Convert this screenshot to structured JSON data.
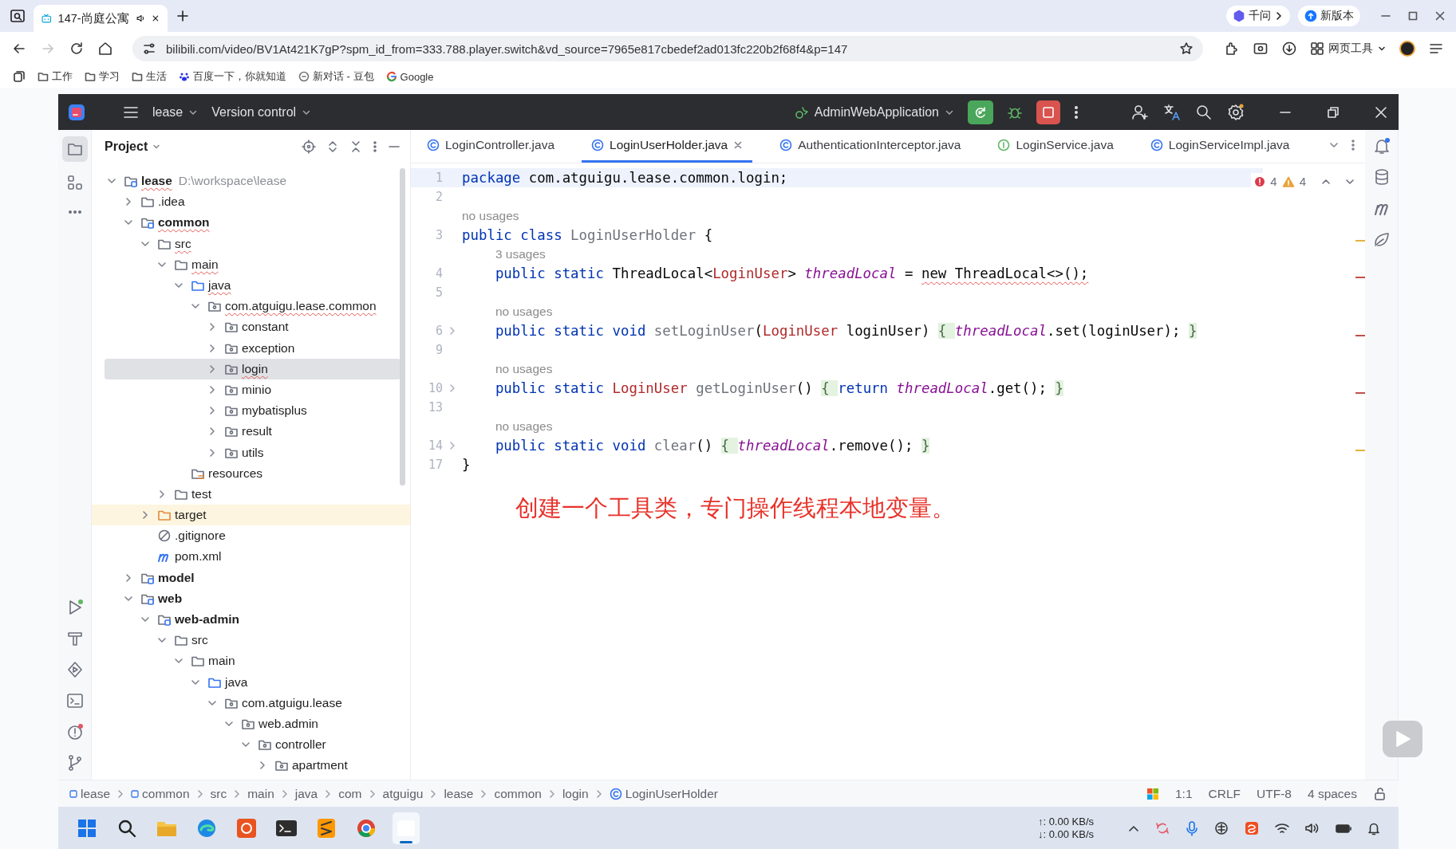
{
  "browser": {
    "tab": {
      "title": "147-尚庭公寓",
      "selected": true
    },
    "forward": {
      "disabled": true
    },
    "address": "bilibili.com/video/BV1At421K7gP?spm_id_from=333.788.player.switch&vd_source=7965e817cbedef2ad013fc220b2f68f4&p=147",
    "qianwen": "千问",
    "update": "新版本",
    "tools": "网页工具",
    "bookmarks": [
      {
        "kind": "folder",
        "label": "工作"
      },
      {
        "kind": "folder",
        "label": "学习"
      },
      {
        "kind": "folder",
        "label": "生活"
      },
      {
        "kind": "paw",
        "label": "百度一下，你就知道"
      },
      {
        "kind": "chat",
        "label": "新对话 - 豆包"
      },
      {
        "kind": "google",
        "label": "Google"
      }
    ]
  },
  "ide": {
    "project": "lease",
    "vcs": "Version control",
    "run_config": "AdminWebApplication",
    "project_panel": {
      "title": "Project",
      "tree": [
        {
          "label": "lease",
          "path": "D:\\workspace\\lease",
          "kind": "module",
          "expanded": true,
          "selected": false,
          "error": true,
          "children": [
            {
              "label": ".idea",
              "kind": "folder",
              "expanded": false,
              "selected": false,
              "error": false
            },
            {
              "label": "common",
              "kind": "module",
              "expanded": true,
              "selected": false,
              "error": true,
              "children": [
                {
                  "label": "src",
                  "kind": "folder",
                  "expanded": true,
                  "selected": false,
                  "error": true,
                  "children": [
                    {
                      "label": "main",
                      "kind": "folder",
                      "expanded": true,
                      "selected": false,
                      "error": true,
                      "children": [
                        {
                          "label": "java",
                          "kind": "source",
                          "expanded": true,
                          "selected": false,
                          "error": true,
                          "children": [
                            {
                              "label": "com.atguigu.lease.common",
                              "kind": "package",
                              "expanded": true,
                              "selected": false,
                              "error": true,
                              "children": [
                                {
                                  "label": "constant",
                                  "kind": "package",
                                  "expanded": false,
                                  "selected": false,
                                  "error": false
                                },
                                {
                                  "label": "exception",
                                  "kind": "package",
                                  "expanded": false,
                                  "selected": false,
                                  "error": false
                                },
                                {
                                  "label": "login",
                                  "kind": "package",
                                  "expanded": false,
                                  "selected": true,
                                  "error": true
                                },
                                {
                                  "label": "minio",
                                  "kind": "package",
                                  "expanded": false,
                                  "selected": false,
                                  "error": false
                                },
                                {
                                  "label": "mybatisplus",
                                  "kind": "package",
                                  "expanded": false,
                                  "selected": false,
                                  "error": false
                                },
                                {
                                  "label": "result",
                                  "kind": "package",
                                  "expanded": false,
                                  "selected": false,
                                  "error": false
                                },
                                {
                                  "label": "utils",
                                  "kind": "package",
                                  "expanded": false,
                                  "selected": false,
                                  "error": false
                                }
                              ]
                            }
                          ]
                        },
                        {
                          "label": "resources",
                          "kind": "resources",
                          "selected": false,
                          "error": false
                        }
                      ]
                    },
                    {
                      "label": "test",
                      "kind": "folder",
                      "expanded": false,
                      "selected": false,
                      "error": false
                    }
                  ]
                },
                {
                  "label": "target",
                  "kind": "excluded",
                  "expanded": false,
                  "selected": false,
                  "error": false
                },
                {
                  "label": ".gitignore",
                  "kind": "ignore",
                  "selected": false,
                  "error": false
                },
                {
                  "label": "pom.xml",
                  "kind": "maven",
                  "selected": false,
                  "error": false
                }
              ]
            },
            {
              "label": "model",
              "kind": "module",
              "expanded": false,
              "selected": false,
              "error": false
            },
            {
              "label": "web",
              "kind": "module",
              "expanded": true,
              "selected": false,
              "error": false,
              "children": [
                {
                  "label": "web-admin",
                  "kind": "module",
                  "expanded": true,
                  "selected": false,
                  "error": false,
                  "children": [
                    {
                      "label": "src",
                      "kind": "folder",
                      "expanded": true,
                      "selected": false,
                      "error": false,
                      "children": [
                        {
                          "label": "main",
                          "kind": "folder",
                          "expanded": true,
                          "selected": false,
                          "error": false,
                          "children": [
                            {
                              "label": "java",
                              "kind": "source",
                              "expanded": true,
                              "selected": false,
                              "error": false,
                              "children": [
                                {
                                  "label": "com.atguigu.lease",
                                  "kind": "package",
                                  "expanded": true,
                                  "selected": false,
                                  "error": false,
                                  "children": [
                                    {
                                      "label": "web.admin",
                                      "kind": "package",
                                      "expanded": true,
                                      "selected": false,
                                      "error": false,
                                      "children": [
                                        {
                                          "label": "controller",
                                          "kind": "package",
                                          "expanded": true,
                                          "selected": false,
                                          "error": false,
                                          "children": [
                                            {
                                              "label": "apartment",
                                              "kind": "package",
                                              "expanded": false,
                                              "selected": false,
                                              "error": false
                                            }
                                          ]
                                        }
                                      ]
                                    }
                                  ]
                                }
                              ]
                            }
                          ]
                        }
                      ]
                    }
                  ]
                }
              ]
            }
          ]
        }
      ]
    },
    "editor": {
      "tabs": [
        {
          "label": "LoginController.java",
          "kind": "class",
          "selected": false
        },
        {
          "label": "LoginUserHolder.java",
          "kind": "class",
          "selected": true
        },
        {
          "label": "AuthenticationInterceptor.java",
          "kind": "class",
          "selected": false
        },
        {
          "label": "LoginService.java",
          "kind": "interface",
          "selected": false
        },
        {
          "label": "LoginServiceImpl.java",
          "kind": "class",
          "selected": false
        }
      ],
      "inspections": {
        "errors": "4",
        "warnings": "4"
      },
      "lines": [
        {
          "number": "1",
          "current": true,
          "folded": false,
          "tokens": [
            {
              "kind": "keyword",
              "text": "package"
            },
            {
              "kind": "plain",
              "text": " com.atguigu.lease.common.login;"
            }
          ]
        },
        {
          "number": "2",
          "current": false,
          "folded": false
        },
        {
          "number": "3",
          "hint": "no usages",
          "current": false,
          "folded": false,
          "tokens": [
            {
              "kind": "keyword",
              "text": "public class"
            },
            {
              "kind": "unused",
              "text": " LoginUserHolder"
            },
            {
              "kind": "plain",
              "text": " {"
            }
          ]
        },
        {
          "number": "4",
          "hint": "3 usages",
          "current": false,
          "folded": false,
          "tokens": [
            {
              "kind": "keyword",
              "text": "    public static"
            },
            {
              "kind": "plain",
              "text": " ThreadLocal<"
            },
            {
              "kind": "reference",
              "text": "LoginUser"
            },
            {
              "kind": "plain",
              "text": "> "
            },
            {
              "kind": "field",
              "text": "threadLocal"
            },
            {
              "kind": "plain",
              "text": " = "
            },
            {
              "kind": "invalid",
              "text": "new ThreadLocal<>();"
            }
          ]
        },
        {
          "number": "5",
          "current": false,
          "folded": false
        },
        {
          "number": "6",
          "hint": "no usages",
          "current": false,
          "folded": true,
          "tokens": [
            {
              "kind": "keyword",
              "text": "    public static void"
            },
            {
              "kind": "unused",
              "text": " setLoginUser"
            },
            {
              "kind": "plain",
              "text": "("
            },
            {
              "kind": "reference",
              "text": "LoginUser"
            },
            {
              "kind": "plain",
              "text": " loginUser) "
            },
            {
              "kind": "folded",
              "text": "{ "
            },
            {
              "kind": "field",
              "text": "threadLocal"
            },
            {
              "kind": "plain",
              "text": ".set(loginUser); "
            },
            {
              "kind": "folded",
              "text": "}"
            }
          ]
        },
        {
          "number": "9",
          "current": false,
          "folded": false
        },
        {
          "number": "10",
          "hint": "no usages",
          "current": false,
          "folded": true,
          "tokens": [
            {
              "kind": "keyword",
              "text": "    public static"
            },
            {
              "kind": "reference",
              "text": " LoginUser"
            },
            {
              "kind": "unused",
              "text": " getLoginUser"
            },
            {
              "kind": "plain",
              "text": "() "
            },
            {
              "kind": "folded",
              "text": "{ "
            },
            {
              "kind": "keyword",
              "text": "return"
            },
            {
              "kind": "field",
              "text": " threadLocal"
            },
            {
              "kind": "plain",
              "text": ".get(); "
            },
            {
              "kind": "folded",
              "text": "}"
            }
          ]
        },
        {
          "number": "13",
          "current": false,
          "folded": false
        },
        {
          "number": "14",
          "hint": "no usages",
          "current": false,
          "folded": true,
          "tokens": [
            {
              "kind": "keyword",
              "text": "    public static void"
            },
            {
              "kind": "unused",
              "text": " clear"
            },
            {
              "kind": "plain",
              "text": "() "
            },
            {
              "kind": "folded",
              "text": "{ "
            },
            {
              "kind": "field",
              "text": "threadLocal"
            },
            {
              "kind": "plain",
              "text": ".remove(); "
            },
            {
              "kind": "folded",
              "text": "}"
            }
          ]
        },
        {
          "number": "17",
          "current": false,
          "folded": false,
          "tokens": [
            {
              "kind": "plain",
              "text": "}"
            }
          ]
        }
      ],
      "stripe_marks": [
        {
          "color": "#e2b33c"
        },
        {
          "color": "#c0504d"
        },
        {
          "color": "#c0504d"
        },
        {
          "color": "#c0504d"
        },
        {
          "color": "#e2b33c"
        }
      ]
    },
    "breadcrumbs": [
      {
        "kind": "module",
        "label": "lease"
      },
      {
        "kind": "module",
        "label": "common"
      },
      {
        "kind": "dir",
        "label": "src"
      },
      {
        "kind": "dir",
        "label": "main"
      },
      {
        "kind": "dir",
        "label": "java"
      },
      {
        "kind": "dir",
        "label": "com"
      },
      {
        "kind": "dir",
        "label": "atguigu"
      },
      {
        "kind": "dir",
        "label": "lease"
      },
      {
        "kind": "dir",
        "label": "common"
      },
      {
        "kind": "dir",
        "label": "login"
      },
      {
        "kind": "class",
        "label": "LoginUserHolder"
      }
    ],
    "status": {
      "position": "1:1",
      "line_separator": "CRLF",
      "encoding": "UTF-8",
      "indent": "4 spaces"
    }
  },
  "subtitle": "创建一个工具类，专门操作线程本地变量。",
  "taskbar": {
    "apps": [
      {
        "kind": "start",
        "active": false
      },
      {
        "kind": "search",
        "active": false
      },
      {
        "kind": "explorer",
        "active": false
      },
      {
        "kind": "edge",
        "active": false
      },
      {
        "kind": "ubuntu",
        "active": false
      },
      {
        "kind": "terminal",
        "active": false
      },
      {
        "kind": "sublime",
        "active": false
      },
      {
        "kind": "chrome",
        "active": false
      },
      {
        "kind": "blank",
        "active": true
      }
    ],
    "upload": "↑: 0.00 KB/s",
    "download": "↓: 0.00 KB/s"
  }
}
